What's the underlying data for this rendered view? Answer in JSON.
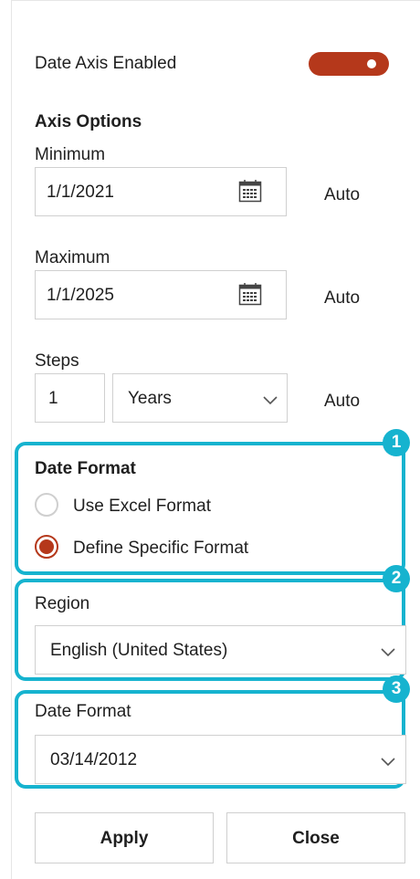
{
  "date_axis": {
    "label": "Date Axis Enabled",
    "enabled": true,
    "accent": "#b5381b"
  },
  "axis_options": {
    "heading": "Axis Options",
    "minimum": {
      "label": "Minimum",
      "value": "1/1/2021",
      "auto": "Auto",
      "icon": "calendar-icon"
    },
    "maximum": {
      "label": "Maximum",
      "value": "1/1/2025",
      "auto": "Auto",
      "icon": "calendar-icon"
    },
    "steps": {
      "label": "Steps",
      "value": "1",
      "unit": "Years",
      "auto": "Auto"
    }
  },
  "date_format_section": {
    "heading": "Date Format",
    "options": [
      {
        "label": "Use Excel Format",
        "checked": false
      },
      {
        "label": "Define Specific Format",
        "checked": true
      }
    ]
  },
  "region": {
    "label": "Region",
    "value": "English (United States)"
  },
  "date_format": {
    "label": "Date Format",
    "value": "03/14/2012"
  },
  "callouts": [
    "1",
    "2",
    "3"
  ],
  "callout_color": "#16b3cf",
  "buttons": {
    "apply": "Apply",
    "close": "Close"
  }
}
